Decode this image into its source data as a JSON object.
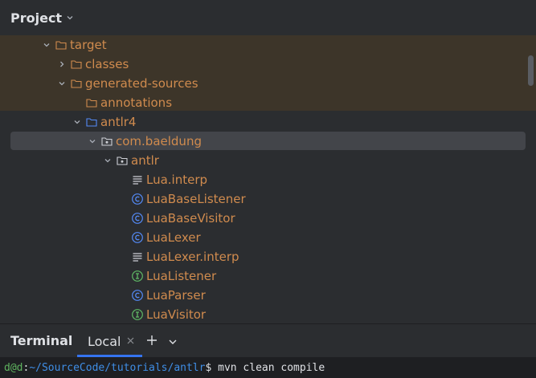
{
  "project_panel": {
    "title": "Project"
  },
  "tree": {
    "rows": [
      {
        "label": "target",
        "icon": "folder-icon"
      },
      {
        "label": "classes",
        "icon": "folder-icon"
      },
      {
        "label": "generated-sources",
        "icon": "folder-icon"
      },
      {
        "label": "annotations",
        "icon": "folder-icon"
      },
      {
        "label": "antlr4",
        "icon": "source-root-folder-icon"
      },
      {
        "label": "com.baeldung",
        "icon": "package-icon"
      },
      {
        "label": "antlr",
        "icon": "package-icon"
      },
      {
        "label": "Lua.interp",
        "icon": "text-file-icon"
      },
      {
        "label": "LuaBaseListener",
        "icon": "class-icon"
      },
      {
        "label": "LuaBaseVisitor",
        "icon": "class-icon"
      },
      {
        "label": "LuaLexer",
        "icon": "class-icon"
      },
      {
        "label": "LuaLexer.interp",
        "icon": "text-file-icon"
      },
      {
        "label": "LuaListener",
        "icon": "interface-icon"
      },
      {
        "label": "LuaParser",
        "icon": "class-icon"
      },
      {
        "label": "LuaVisitor",
        "icon": "interface-icon"
      }
    ]
  },
  "terminal": {
    "title": "Terminal",
    "tab_label": "Local",
    "prompt_user": "d@d",
    "prompt_sep": ":",
    "prompt_path": "~/SourceCode/tutorials/antlr",
    "prompt_symbol": "$",
    "command": " mvn clean compile"
  },
  "colors": {
    "excluded_folder_text": "#d08b4e",
    "excluded_background": "#3d3529",
    "selection": "#43454a",
    "accent": "#3574f0",
    "class_icon": "#548af7",
    "interface_icon": "#5fb865"
  }
}
